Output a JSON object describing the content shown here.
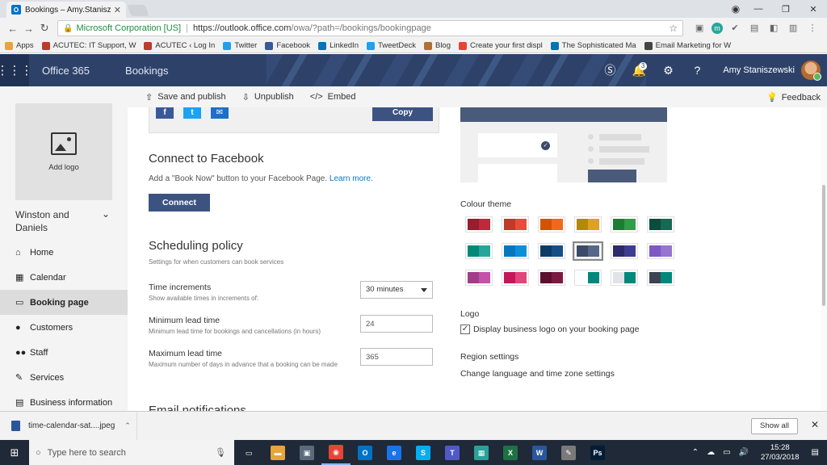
{
  "browser": {
    "tab_title": "Bookings – Amy.Stanisze",
    "tab_icon": "O",
    "secure_label": "Microsoft Corporation [US]",
    "url_host": "https://outlook.office.com",
    "url_path": "/owa/?path=/bookings/bookingpage",
    "bookmarks": [
      {
        "label": "Apps",
        "color": "#e8a33c"
      },
      {
        "label": "ACUTEC: IT Support, W",
        "color": "#c0392b"
      },
      {
        "label": "ACUTEC ‹ Log In",
        "color": "#c0392b"
      },
      {
        "label": "Twitter",
        "color": "#1da1f2"
      },
      {
        "label": "Facebook",
        "color": "#3b5998"
      },
      {
        "label": "LinkedIn",
        "color": "#0077b5"
      },
      {
        "label": "TweetDeck",
        "color": "#1da1f2"
      },
      {
        "label": "Blog",
        "color": "#b07030"
      },
      {
        "label": "Create your first displ",
        "color": "#ea4335"
      },
      {
        "label": "The Sophisticated Ma",
        "color": "#0077b5"
      },
      {
        "label": "Email Marketing for W",
        "color": "#444444"
      }
    ]
  },
  "office": {
    "brand": "Office 365",
    "app": "Bookings",
    "notification_count": "3",
    "user_name": "Amy Staniszewski"
  },
  "toolbar": {
    "save": "Save and publish",
    "unpublish": "Unpublish",
    "embed": "Embed",
    "feedback": "Feedback"
  },
  "sidebar": {
    "add_logo": "Add logo",
    "business_name": "Winston and Daniels",
    "items": [
      {
        "label": "Home",
        "icon": "⌂"
      },
      {
        "label": "Calendar",
        "icon": "▦"
      },
      {
        "label": "Booking page",
        "icon": "▭"
      },
      {
        "label": "Customers",
        "icon": "●"
      },
      {
        "label": "Staff",
        "icon": "●●"
      },
      {
        "label": "Services",
        "icon": "✎"
      },
      {
        "label": "Business information",
        "icon": "▤"
      }
    ]
  },
  "share": {
    "copy_label": "Copy"
  },
  "facebook": {
    "title": "Connect to Facebook",
    "desc": "Add a \"Book Now\" button to your Facebook Page.",
    "learn_more": "Learn more.",
    "connect": "Connect"
  },
  "scheduling": {
    "title": "Scheduling policy",
    "subtitle": "Settings for when customers can book services",
    "time_increments_label": "Time increments",
    "time_increments_help": "Show available times in increments of:",
    "time_increments_value": "30 minutes",
    "min_lead_label": "Minimum lead time",
    "min_lead_help": "Minimum lead time for bookings and cancellations (in hours)",
    "min_lead_value": "24",
    "max_lead_label": "Maximum lead time",
    "max_lead_help": "Maximum number of days in advance that a booking can be made",
    "max_lead_value": "365",
    "next_section": "Email notifications"
  },
  "theme": {
    "title": "Colour theme",
    "swatches": [
      [
        "#9b1b30",
        "#c0283e"
      ],
      [
        "#c0392b",
        "#e74c3c"
      ],
      [
        "#d35400",
        "#f06a1d"
      ],
      [
        "#b8860b",
        "#e0a020"
      ],
      [
        "#1e7b34",
        "#2e9e48"
      ],
      [
        "#0b4d3c",
        "#136b54"
      ],
      [
        "#00897b",
        "#26a69a"
      ],
      [
        "#0277bd",
        "#0b8fd8"
      ],
      [
        "#0d3b66",
        "#174f85"
      ],
      [
        "#3c4a6a",
        "#56658a"
      ],
      [
        "#2c2a6b",
        "#3e3c8f"
      ],
      [
        "#7e57c2",
        "#9575cd"
      ],
      [
        "#a23d8a",
        "#c352a8"
      ],
      [
        "#c2185b",
        "#e0457b"
      ],
      [
        "#5c0f2e",
        "#7a1a40"
      ],
      [
        "#ffffff",
        "#00897b"
      ],
      [
        "#e0e3ea",
        "#00897b"
      ],
      [
        "#3c4450",
        "#00897b"
      ]
    ],
    "selected_index": 9
  },
  "logo": {
    "title": "Logo",
    "checkbox_label": "Display business logo on your booking page"
  },
  "region": {
    "title": "Region settings",
    "link": "Change language and time zone settings"
  },
  "downloads": {
    "file": "time-calendar-sat....jpeg",
    "show_all": "Show all"
  },
  "taskbar": {
    "search_placeholder": "Type here to search",
    "time": "15:28",
    "date": "27/03/2018",
    "apps": [
      {
        "icon": "▭",
        "color": "#1f2937"
      },
      {
        "icon": "▬",
        "color": "#e8a33c"
      },
      {
        "icon": "▣",
        "color": "#5b6b7c"
      },
      {
        "icon": "◉",
        "color": "#ea4335"
      },
      {
        "icon": "O",
        "color": "#0072c6"
      },
      {
        "icon": "e",
        "color": "#1a73e8"
      },
      {
        "icon": "S",
        "color": "#00aff0"
      },
      {
        "icon": "T",
        "color": "#5059c9"
      },
      {
        "icon": "▦",
        "color": "#2aa198"
      },
      {
        "icon": "X",
        "color": "#1e7145"
      },
      {
        "icon": "W",
        "color": "#2b579a"
      },
      {
        "icon": "✎",
        "color": "#7a7a7a"
      },
      {
        "icon": "Ps",
        "color": "#001e36"
      }
    ]
  }
}
